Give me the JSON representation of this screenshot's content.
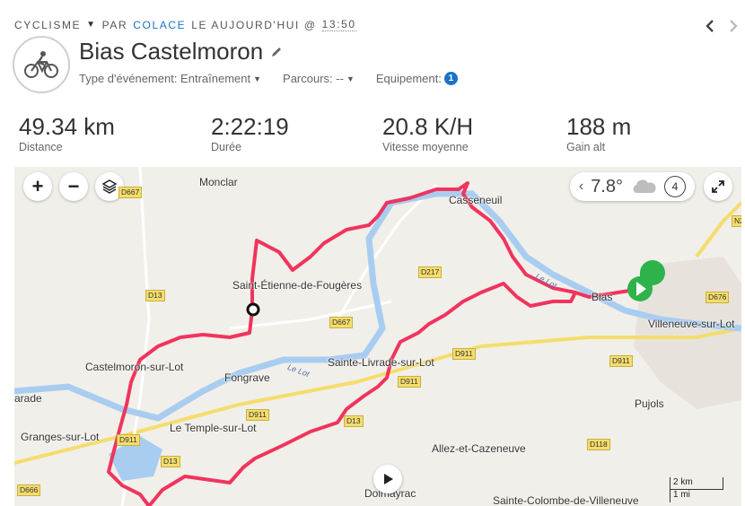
{
  "header": {
    "sport": "CYCLISME",
    "by": "PAR",
    "author": "COLACE",
    "date_prefix": "LE AUJOURD'HUI @",
    "time": "13:50"
  },
  "nav": {
    "prev_icon": "chevron-left-icon",
    "next_icon": "chevron-right-icon"
  },
  "activity": {
    "icon": "bicycle-icon",
    "title": "Bias Castelmoron",
    "event_type": "Type d'événement: Entraînement",
    "course": "Parcours: --",
    "equipment_label": "Equipement:",
    "equipment_count": "1"
  },
  "stats": [
    {
      "value": "49.34 km",
      "label": "Distance"
    },
    {
      "value": "2:22:19",
      "label": "Durée"
    },
    {
      "value": "20.8 K/H",
      "label": "Vitesse moyenne"
    },
    {
      "value": "188 m",
      "label": "Gain alt"
    }
  ],
  "map": {
    "zoom_in": "+",
    "zoom_out": "−",
    "weather": {
      "temperature": "7.8°",
      "wind": "4",
      "icon": "cloud-icon"
    },
    "places": [
      "Monclar",
      "Casseneuil",
      "Saint-Étienne-de-Fougères",
      "Castelmoron-sur-Lot",
      "Fongrave",
      "Sainte-Livrade-sur-Lot",
      "Bias",
      "Villeneuve-sur-Lot",
      "Pujols",
      "Granges-sur-Lot",
      "Le Temple-sur-Lot",
      "Allez-et-Cazeneuve",
      "Dolmayrac",
      "Sainte-Colombe-de-Villeneuve",
      "arade"
    ],
    "roads": [
      "D667",
      "D13",
      "D217",
      "D667",
      "D911",
      "D911",
      "D911",
      "D676",
      "D911",
      "D13",
      "D911",
      "D13",
      "D118",
      "D666",
      "N2"
    ],
    "river_labels": [
      "Le Lot",
      "Le Lot"
    ],
    "scale": {
      "km": "2 km",
      "mi": "1 mi"
    },
    "colors": {
      "route": "#f0345e",
      "river": "#a9cdf0",
      "start": "#2eb34b",
      "road": "#f4dd6c"
    }
  }
}
